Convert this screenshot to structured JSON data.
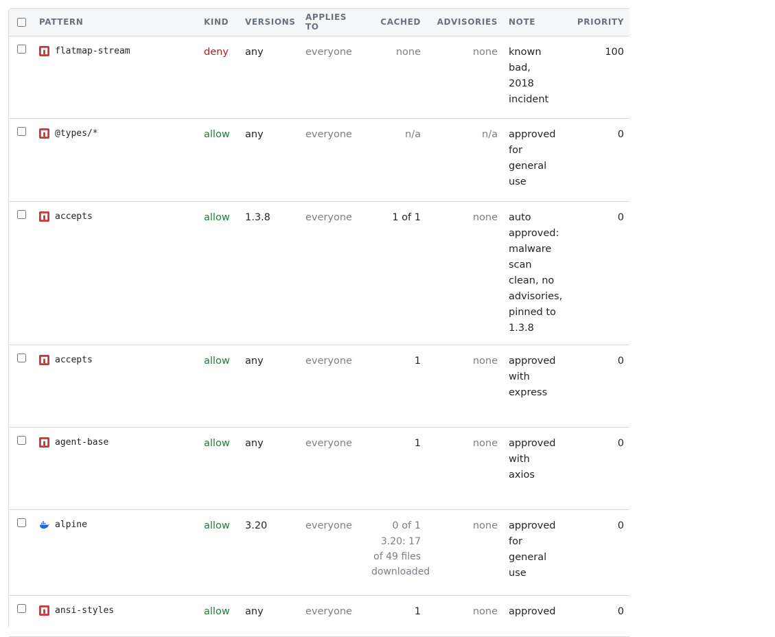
{
  "columns": {
    "pattern": "PATTERN",
    "kind": "KIND",
    "versions": "VERSIONS",
    "applies_to": "APPLIES TO",
    "cached": "CACHED",
    "advisories": "ADVISORIES",
    "note": "NOTE",
    "priority": "PRIORITY"
  },
  "rows": [
    {
      "icon": "npm-icon",
      "pattern": "flatmap-stream",
      "kind": "deny",
      "versions": "any",
      "applies_to": "everyone",
      "cached": "none",
      "cached_detail": "",
      "advisories": "none",
      "note": "known bad, 2018 incident",
      "priority": "100"
    },
    {
      "icon": "npm-icon",
      "pattern": "@types/*",
      "kind": "allow",
      "versions": "any",
      "applies_to": "everyone",
      "cached": "n/a",
      "cached_detail": "",
      "advisories": "n/a",
      "note": "approved for general use",
      "priority": "0"
    },
    {
      "icon": "npm-icon",
      "pattern": "accepts",
      "kind": "allow",
      "versions": "1.3.8",
      "applies_to": "everyone",
      "cached": "1 of 1",
      "cached_detail": "",
      "advisories": "none",
      "note": "auto approved: malware scan clean, no advisories, pinned to 1.3.8",
      "priority": "0"
    },
    {
      "icon": "npm-icon",
      "pattern": "accepts",
      "kind": "allow",
      "versions": "any",
      "applies_to": "everyone",
      "cached": "1",
      "cached_detail": "",
      "advisories": "none",
      "note": "approved with express",
      "priority": "0"
    },
    {
      "icon": "npm-icon",
      "pattern": "agent-base",
      "kind": "allow",
      "versions": "any",
      "applies_to": "everyone",
      "cached": "1",
      "cached_detail": "",
      "advisories": "none",
      "note": "approved with axios",
      "priority": "0"
    },
    {
      "icon": "docker-icon",
      "pattern": "alpine",
      "kind": "allow",
      "versions": "3.20",
      "applies_to": "everyone",
      "cached": "0 of 1",
      "cached_detail": "3.20: 17 of 49 files downloaded",
      "advisories": "none",
      "note": "approved for general use",
      "priority": "0"
    },
    {
      "icon": "npm-icon",
      "pattern": "ansi-styles",
      "kind": "allow",
      "versions": "any",
      "applies_to": "everyone",
      "cached": "1",
      "cached_detail": "",
      "advisories": "none",
      "note": "approved",
      "priority": "0"
    }
  ],
  "colors": {
    "deny": "#b31d28",
    "allow": "#1a7f37",
    "npm_brand": "#cb3837",
    "docker_brand": "#1d63ed"
  }
}
